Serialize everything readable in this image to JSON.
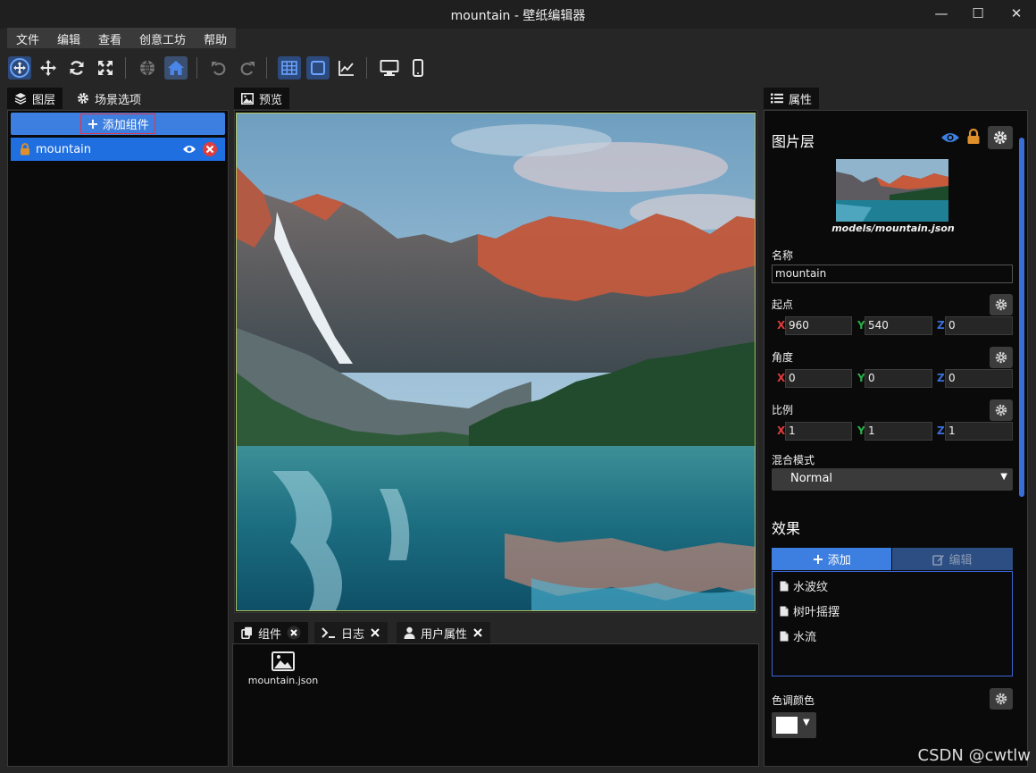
{
  "window": {
    "title": "mountain - 壁纸编辑器",
    "minimize": "—",
    "maximize": "☐",
    "close": "✕"
  },
  "menu": [
    "文件",
    "编辑",
    "查看",
    "创意工坊",
    "帮助"
  ],
  "left": {
    "tabs": [
      "图层",
      "场景选项"
    ],
    "add_component": "添加组件",
    "layer_name": "mountain"
  },
  "preview": {
    "tab": "预览"
  },
  "bottom": {
    "tabs": [
      "组件",
      "日志",
      "用户属性"
    ],
    "file_name": "mountain.json"
  },
  "properties": {
    "tab": "属性",
    "header": "图片层",
    "model_path": "models/mountain.json",
    "name_label": "名称",
    "name_value": "mountain",
    "origin_label": "起点",
    "origin": {
      "x": "960",
      "y": "540",
      "z": "0"
    },
    "angle_label": "角度",
    "angle": {
      "x": "0",
      "y": "0",
      "z": "0"
    },
    "scale_label": "比例",
    "scale": {
      "x": "1",
      "y": "1",
      "z": "1"
    },
    "axis_x": "X",
    "axis_y": "Y",
    "axis_z": "Z",
    "blend_label": "混合模式",
    "blend_value": "Normal",
    "effects_title": "效果",
    "add_label": "添加",
    "edit_label": "编辑",
    "effects": [
      "水波纹",
      "树叶摇摆",
      "水流"
    ],
    "tint_label": "色调颜色",
    "tint_color": "#ffffff"
  },
  "watermark": "CSDN @cwtlw",
  "colors": {
    "accent": "#3d7fe0",
    "selected": "#1f6fe0",
    "lock": "#e0902a",
    "remove": "#e03c3c"
  }
}
